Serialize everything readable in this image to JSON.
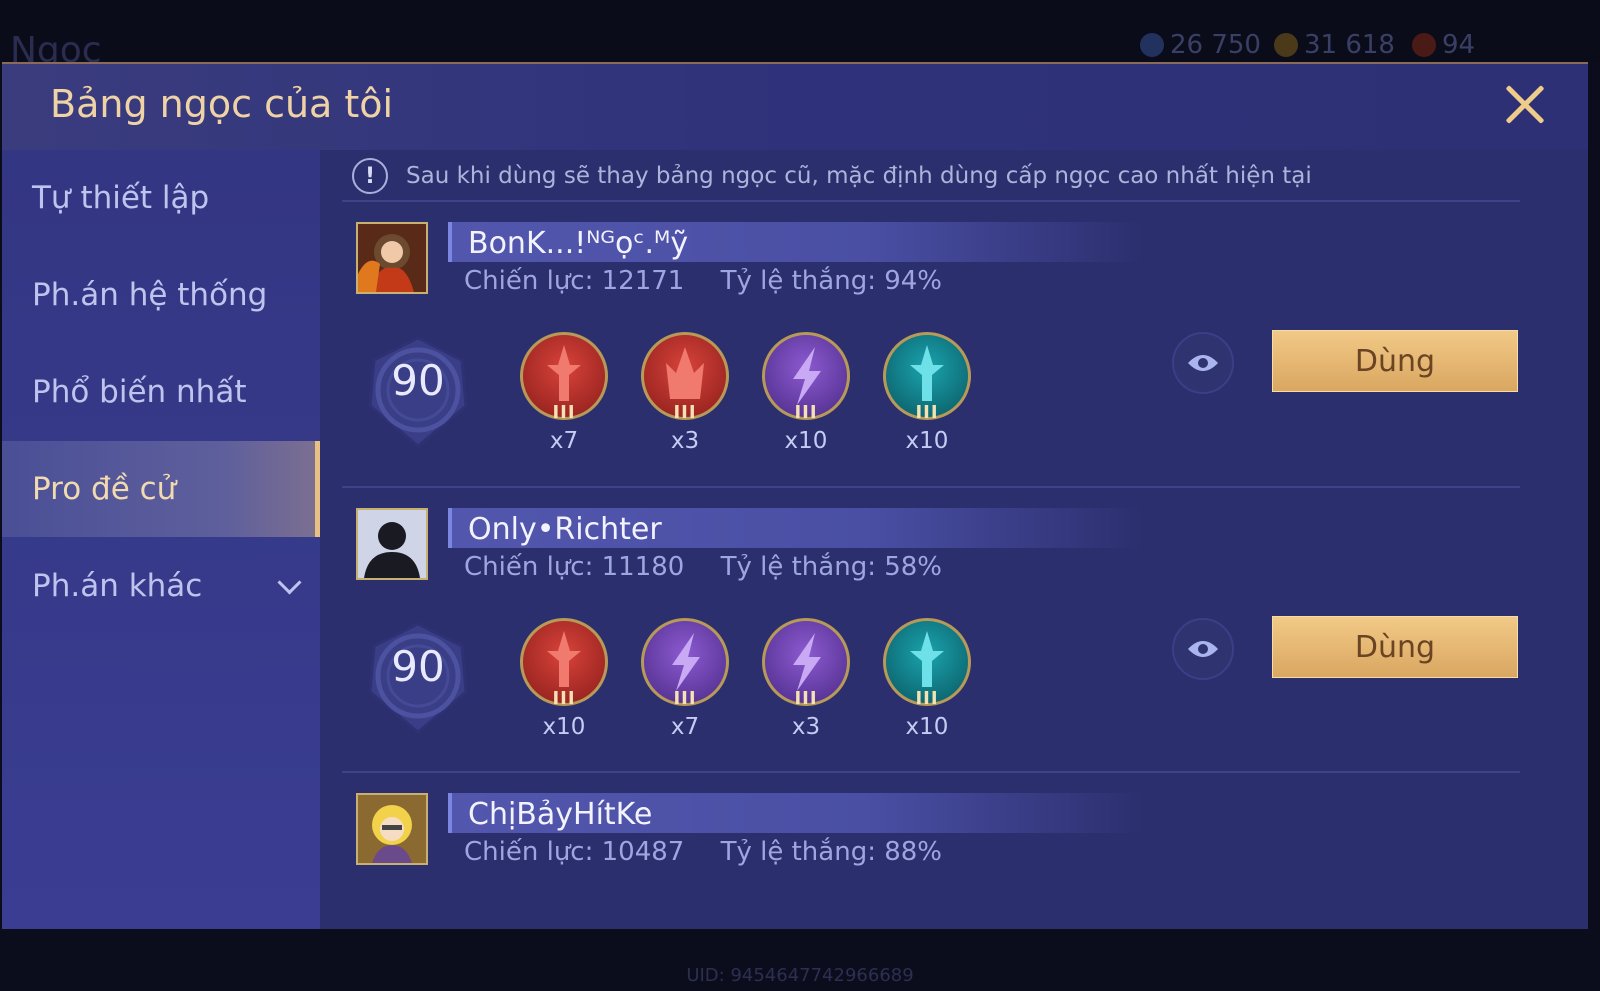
{
  "background": {
    "title": "Ngọc",
    "currencies": [
      {
        "icon": "diamond-coin-icon",
        "value": "26 750",
        "color": "#3c5fa8"
      },
      {
        "icon": "gold-coin-icon",
        "value": "31 618",
        "color": "#b9862f"
      },
      {
        "icon": "red-gem-icon",
        "value": "94",
        "color": "#a0352b"
      }
    ],
    "uid": "UID: 9454647742966689"
  },
  "dialog": {
    "title": "Bảng ngọc của tôi",
    "close_icon": "close-icon"
  },
  "sidebar": {
    "items": [
      {
        "label": "Tự thiết lập",
        "active": false
      },
      {
        "label": "Ph.án hệ thống",
        "active": false
      },
      {
        "label": "Phổ biến nhất",
        "active": false
      },
      {
        "label": "Pro đề cử",
        "active": true
      },
      {
        "label": "Ph.án khác",
        "active": false,
        "dropdown": true
      }
    ]
  },
  "notice": {
    "icon": "!",
    "text": "Sau khi dùng sẽ thay bảng ngọc cũ, mặc định dùng cấp ngọc cao nhất hiện tại"
  },
  "colors": {
    "red_gem": "#b02a25",
    "purple_gem": "#6a3aa8",
    "cyan_gem": "#0e7a84",
    "accent_gold": "#e8c084"
  },
  "entries": [
    {
      "name": "BonK...!ᴺᴳọᶜ.ᴹỹ",
      "power": "Chiến lực: 12171",
      "winrate": "Tỷ lệ thắng: 94%",
      "level": "90",
      "gems": [
        {
          "type": "red-sword",
          "rank": "III",
          "count": "x7"
        },
        {
          "type": "red-flame",
          "rank": "III",
          "count": "x3"
        },
        {
          "type": "purple-bolt",
          "rank": "III",
          "count": "x10"
        },
        {
          "type": "cyan-sword",
          "rank": "III",
          "count": "x10"
        }
      ],
      "use_label": "Dùng",
      "avatar": "hero-portrait"
    },
    {
      "name": "Only•Richter",
      "power": "Chiến lực: 11180",
      "winrate": "Tỷ lệ thắng: 58%",
      "level": "90",
      "gems": [
        {
          "type": "red-sword",
          "rank": "III",
          "count": "x10"
        },
        {
          "type": "purple-bolt",
          "rank": "III",
          "count": "x7"
        },
        {
          "type": "purple-bolt",
          "rank": "III",
          "count": "x3"
        },
        {
          "type": "cyan-sword",
          "rank": "III",
          "count": "x10"
        }
      ],
      "use_label": "Dùng",
      "avatar": "silhouette"
    },
    {
      "name": "ChịBảyHítKe",
      "power": "Chiến lực: 10487",
      "winrate": "Tỷ lệ thắng: 88%",
      "level": "",
      "gems": [],
      "use_label": "",
      "avatar": "blonde-portrait"
    }
  ]
}
